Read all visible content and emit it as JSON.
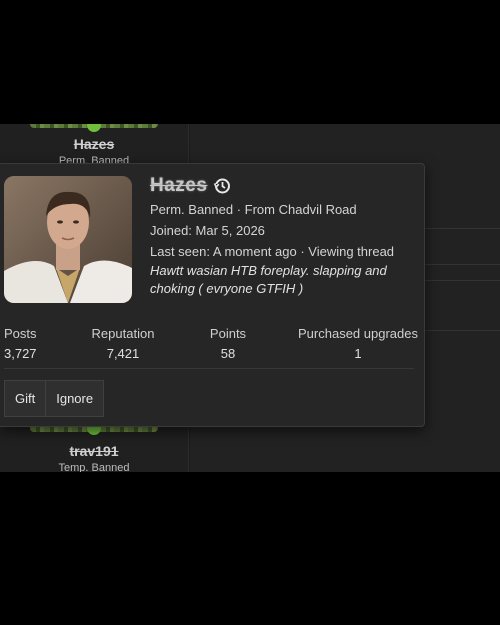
{
  "background_users": [
    {
      "name": "Hazes",
      "title_visible": "Perm. Banned"
    },
    {
      "name": "trav191",
      "title_visible": "Temp. Banned"
    }
  ],
  "popup": {
    "username": "Hazes",
    "history_icon": "history-icon",
    "status_line": "Perm. Banned · From Chadvil Road",
    "joined": "Joined: Mar 5, 2026",
    "last_seen": "Last seen: A moment ago · Viewing thread",
    "thread_title": "Hawtt wasian HTB foreplay. slapping and choking ( evryone GTFIH )",
    "stats": [
      {
        "label": "Posts",
        "value": "3,727"
      },
      {
        "label": "Reputation",
        "value": "7,421"
      },
      {
        "label": "Points",
        "value": "58"
      },
      {
        "label": "Purchased upgrades",
        "value": "1"
      }
    ],
    "buttons": {
      "gift": "Gift",
      "ignore": "Ignore"
    }
  },
  "colors": {
    "online": "#6fbf3a",
    "popup_bg": "#262626",
    "page_bg": "#1b1b1b"
  }
}
